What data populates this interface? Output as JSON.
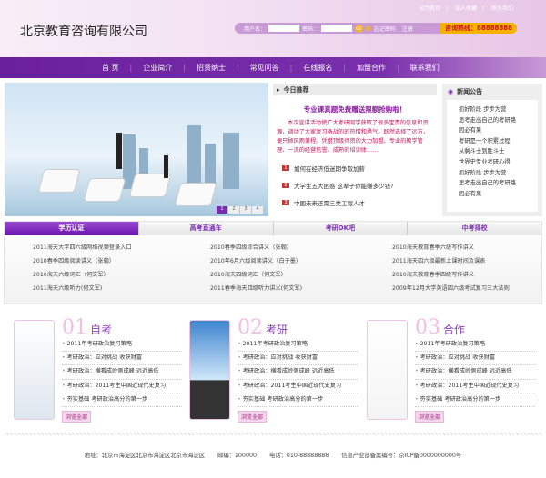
{
  "header": {
    "logo": "北京教育咨询有限公司",
    "toplinks": [
      "设为首页",
      "加入收藏",
      "联系我们"
    ],
    "login": {
      "user_label": "用户名：",
      "pass_label": "密码：",
      "go": "GO",
      "forgot": "忘记密码",
      "register": "注册"
    },
    "hotline": "咨询热线：88888888"
  },
  "nav": [
    "首 页",
    "企业简介",
    "招贤纳士",
    "常见问答",
    "在线报名",
    "加盟合作",
    "联系我们"
  ],
  "banner": {
    "pages": [
      "1",
      "2",
      "3",
      "4"
    ],
    "active": 1
  },
  "today": {
    "title": "今日推荐",
    "headline": "专业课真题免费赠送限额抢购啦！",
    "body": "本次宣讲活动使广大考研同学获取了很多宝贵的信息和资源，调动了大家复习备战的的热情和勇气。既然选择了远方，便只顾风雨兼程。凭借顶级师资的大力加盟、专业的教学管理、一流的经营信誉、成熟的培训体……",
    "items": [
      "如何在经济低迷期争取加薪",
      "大学生五大困惑 这辈子你能赚多少钱?",
      "中国未来还需三类工程人才"
    ]
  },
  "news": {
    "title": "新闻公告",
    "items": [
      "抓好阶段 步步为营",
      "思考走出自己的考研路",
      "因必有果",
      "考研是一个积累过程",
      "从剩斗士到胜斗士",
      "世界史专业考研心得",
      "抓好阶段 步步为营",
      "思考走出自己的考研路",
      "因必有果"
    ]
  },
  "tabs": {
    "labels": [
      "学历认证",
      "高考直通车",
      "考研OK吧",
      "中考择校"
    ],
    "active": 0,
    "items": [
      "2011海天大学四六级网络视频登录入口",
      "2010春季四级综合讲义（张翰）",
      "2010海天教育春季六级写作讲义",
      "2010春季四级阅读讲义（张翰）",
      "2010年6月六级阅读讲义（白子墨）",
      "2011海天四六级最新上课时间及课表",
      "2010海天六级词汇（何文军）",
      "2010海天四级词汇（何文军）",
      "2010海天教育春季四级写作讲义",
      "2011海天六级听力(何文军)",
      "2011春季海天四级听力讲义(何文军)",
      "2009年12月大学英语四六级考试复习三大法则"
    ]
  },
  "sections": [
    {
      "num": "01",
      "title": "自考",
      "items": [
        "2011年考研政治复习策略",
        "考研政治：应对挑战 收获财富",
        "考研政治：横看成岭侧成峰 远近高低",
        "考研政治：2011考生中国近现代史复习",
        "夯实基础 考研政治高分的第一步"
      ],
      "more": "浏览全部"
    },
    {
      "num": "02",
      "title": "考研",
      "items": [
        "2011年考研政治复习策略",
        "考研政治：应对挑战 收获财富",
        "考研政治：横看成岭侧成峰 远近高低",
        "考研政治：2011考生中国近现代史复习",
        "夯实基础 考研政治高分的第一步"
      ],
      "more": "浏览全部"
    },
    {
      "num": "03",
      "title": "合作",
      "items": [
        "2011年考研政治复习策略",
        "考研政治：应对挑战 收获财富",
        "考研政治：横看成岭侧成峰 远近高低",
        "考研政治：2011考生中国近现代史复习",
        "夯实基础 考研政治高分的第一步"
      ],
      "more": "浏览全部"
    }
  ],
  "footer": {
    "address": "地址：北京市海淀区北京市海淀区北京市海淀区",
    "postcode": "邮编：100000",
    "phone": "电话：010-88888888",
    "icp": "信息产业部备案编号：京ICP备0000000000号"
  },
  "colors": {
    "brand": "#7a2fac",
    "hotline": "#f9b100"
  }
}
